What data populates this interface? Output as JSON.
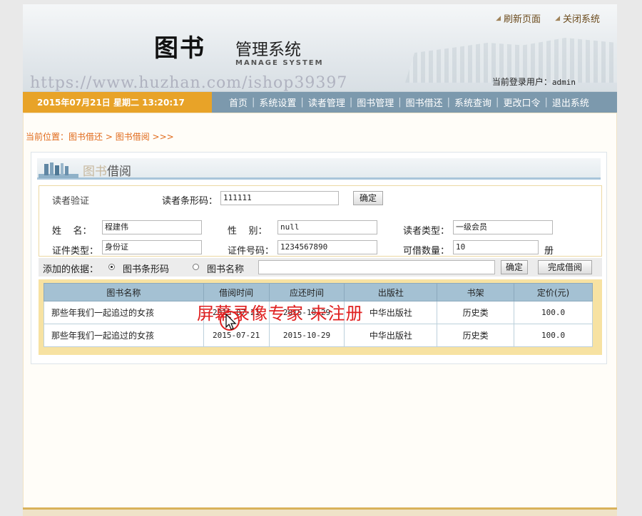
{
  "header": {
    "logo_main": "图书",
    "logo_sub": "管理系统",
    "logo_en": "MANAGE SYSTEM",
    "watermark_url": "https://www.huzhan.com/ishop39397",
    "links": [
      "刷新页面",
      "关闭系统"
    ],
    "login_label": "当前登录用户：",
    "login_user": "admin"
  },
  "navbar": {
    "datetime": "2015年07月21日 星期二 13:20:17",
    "menu": [
      "首页",
      "系统设置",
      "读者管理",
      "图书管理",
      "图书借还",
      "系统查询",
      "更改口令",
      "退出系统"
    ]
  },
  "breadcrumb": {
    "prefix": "当前位置：",
    "level1": "图书借还",
    "sep": " > ",
    "level2": "图书借阅",
    "suffix": " >>>"
  },
  "panel": {
    "title_ghost": "图书",
    "title": "借阅"
  },
  "reader": {
    "section_label": "读者验证",
    "barcode_label": "读者条形码：",
    "barcode_value": "111111",
    "confirm_label": "确定",
    "name_label": "姓    名：",
    "name_value": "程建伟",
    "gender_label": "性    别：",
    "gender_value": "null",
    "type_label": "读者类型：",
    "type_value": "一级会员",
    "id_type_label": "证件类型：",
    "id_type_value": "身份证",
    "id_no_label": "证件号码：",
    "id_no_value": "1234567890",
    "quota_label": "可借数量：",
    "quota_value": "10",
    "quota_unit": "册"
  },
  "add": {
    "label": "添加的依据：",
    "option_barcode": "图书条形码",
    "option_name": "图书名称",
    "input_value": "",
    "confirm_label": "确定",
    "finish_label": "完成借阅"
  },
  "table": {
    "headers": [
      "图书名称",
      "借阅时间",
      "应还时间",
      "出版社",
      "书架",
      "定价(元)"
    ],
    "rows": [
      [
        "那些年我们一起追过的女孩",
        "2015-07-21",
        "2015-10-29",
        "中华出版社",
        "历史类",
        "100.0"
      ],
      [
        "那些年我们一起追过的女孩",
        "2015-07-21",
        "2015-10-29",
        "中华出版社",
        "历史类",
        "100.0"
      ]
    ]
  },
  "recorder_watermark": "屏幕录像专家  未注册",
  "colors": {
    "nav_bar": "#7c99ad",
    "date_box": "#e8a328",
    "breadcrumb": "#e06a1b",
    "table_header": "#a4c1d3",
    "table_frame": "#f7e2a2",
    "watermark_red": "#e02020"
  }
}
